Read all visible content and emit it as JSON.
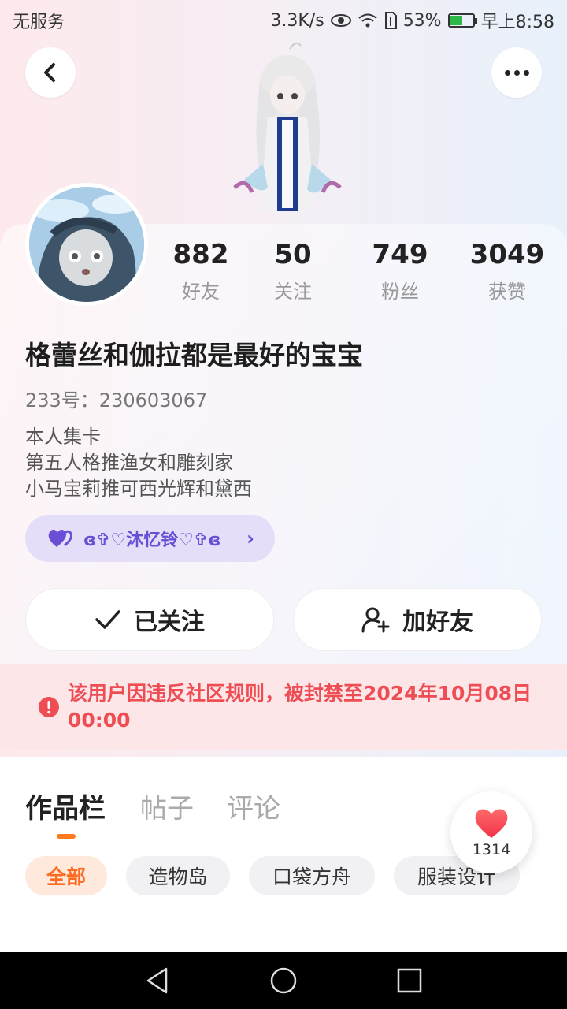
{
  "status_bar": {
    "carrier": "无服务",
    "speed": "3.3K/s",
    "battery": "53%",
    "time": "早上8:58",
    "icons": [
      "eye-icon",
      "wifi-icon",
      "sim-icon",
      "battery-icon"
    ]
  },
  "header": {
    "back_icon": "chevron-left-icon",
    "more_icon": "more-dots-icon"
  },
  "stats": [
    {
      "num": "882",
      "label": "好友"
    },
    {
      "num": "50",
      "label": "关注"
    },
    {
      "num": "749",
      "label": "粉丝"
    },
    {
      "num": "3049",
      "label": "获赞"
    }
  ],
  "profile": {
    "username": "格蕾丝和伽拉都是最好的宝宝",
    "uid": "233号：230603067",
    "bio": [
      "本人集卡",
      "第五人格推渔女和雕刻家",
      "小马宝莉推可西光辉和黛西"
    ],
    "cp_label": "ɞ✞♡沐忆铃♡✞ɞ",
    "cp_icon": "double-heart-icon"
  },
  "actions": {
    "followed": "已关注",
    "add_friend": "加好友"
  },
  "ban_notice": "该用户因违反社区规则，被封禁至2024年10月08日 00:00",
  "tabs": [
    "作品栏",
    "帖子",
    "评论"
  ],
  "active_tab": 0,
  "chips": [
    "全部",
    "造物岛",
    "口袋方舟",
    "服装设计"
  ],
  "active_chip": 0,
  "like_float": {
    "count": "1314",
    "icon": "heart-icon"
  },
  "colors": {
    "accent_orange": "#ff7a1a",
    "ban_red": "#ee4d53",
    "cp_purple": "#6a4fd6"
  }
}
